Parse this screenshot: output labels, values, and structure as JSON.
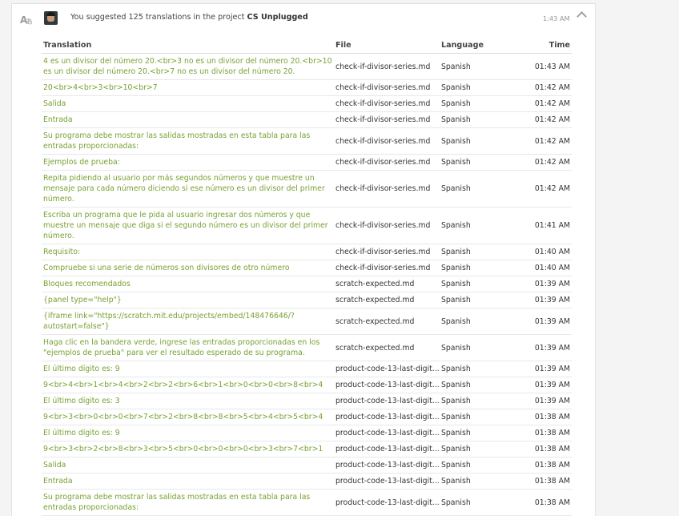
{
  "header": {
    "summary_prefix": "You suggested 125 translations in the project",
    "project": "CS Unplugged",
    "time": "1:43 AM"
  },
  "columns": {
    "translation": "Translation",
    "file": "File",
    "language": "Language",
    "time": "Time"
  },
  "rows": [
    {
      "translation": "4 es un divisor del número 20.<br>3 no es un divisor del número 20.<br>10 es un divisor del número 20.<br>7 no es un divisor del número 20.",
      "file": "check-if-divisor-series.md",
      "language": "Spanish",
      "time": "01:43 AM"
    },
    {
      "translation": "20<br>4<br>3<br>10<br>7",
      "file": "check-if-divisor-series.md",
      "language": "Spanish",
      "time": "01:42 AM"
    },
    {
      "translation": "Salida",
      "file": "check-if-divisor-series.md",
      "language": "Spanish",
      "time": "01:42 AM"
    },
    {
      "translation": "Entrada",
      "file": "check-if-divisor-series.md",
      "language": "Spanish",
      "time": "01:42 AM"
    },
    {
      "translation": "Su programa debe mostrar las salidas mostradas en esta tabla para las entradas proporcionadas:",
      "file": "check-if-divisor-series.md",
      "language": "Spanish",
      "time": "01:42 AM"
    },
    {
      "translation": "Ejemplos de prueba:",
      "file": "check-if-divisor-series.md",
      "language": "Spanish",
      "time": "01:42 AM"
    },
    {
      "translation": "Repita pidiendo al usuario por más segundos números y que muestre un mensaje para cada número diciendo si ese número es un divisor del primer número.",
      "file": "check-if-divisor-series.md",
      "language": "Spanish",
      "time": "01:42 AM"
    },
    {
      "translation": "Escriba un programa que le pida al usuario ingresar dos números y que muestre un mensaje que diga si el segundo número es un divisor del primer número.",
      "file": "check-if-divisor-series.md",
      "language": "Spanish",
      "time": "01:41 AM"
    },
    {
      "translation": "Requisito:",
      "file": "check-if-divisor-series.md",
      "language": "Spanish",
      "time": "01:40 AM"
    },
    {
      "translation": "Compruebe si una serie de números son divisores de otro número",
      "file": "check-if-divisor-series.md",
      "language": "Spanish",
      "time": "01:40 AM"
    },
    {
      "translation": "Bloques recomendados",
      "file": "scratch-expected.md",
      "language": "Spanish",
      "time": "01:39 AM"
    },
    {
      "translation": "{panel type=\"help\"}",
      "file": "scratch-expected.md",
      "language": "Spanish",
      "time": "01:39 AM"
    },
    {
      "translation": "{iframe link=\"https://scratch.mit.edu/projects/embed/148476646/?autostart=false\"}",
      "file": "scratch-expected.md",
      "language": "Spanish",
      "time": "01:39 AM"
    },
    {
      "translation": "Haga clic en la bandera verde, ingrese las entradas proporcionadas en los \"ejemplos de prueba\" para ver el resultado esperado de su programa.",
      "file": "scratch-expected.md",
      "language": "Spanish",
      "time": "01:39 AM"
    },
    {
      "translation": "El último dígito es: 9",
      "file": "product-code-13-last-digit...",
      "language": "Spanish",
      "time": "01:39 AM"
    },
    {
      "translation": "9<br>4<br>1<br>4<br>2<br>2<br>6<br>1<br>0<br>0<br>8<br>4",
      "file": "product-code-13-last-digit...",
      "language": "Spanish",
      "time": "01:39 AM"
    },
    {
      "translation": "El último dígito es: 3",
      "file": "product-code-13-last-digit...",
      "language": "Spanish",
      "time": "01:39 AM"
    },
    {
      "translation": "9<br>3<br>0<br>0<br>7<br>2<br>8<br>8<br>5<br>4<br>5<br>4",
      "file": "product-code-13-last-digit...",
      "language": "Spanish",
      "time": "01:38 AM"
    },
    {
      "translation": "El último dígito es: 9",
      "file": "product-code-13-last-digit...",
      "language": "Spanish",
      "time": "01:38 AM"
    },
    {
      "translation": "9<br>3<br>2<br>8<br>3<br>5<br>0<br>0<br>0<br>3<br>7<br>1",
      "file": "product-code-13-last-digit...",
      "language": "Spanish",
      "time": "01:38 AM"
    },
    {
      "translation": "Salida",
      "file": "product-code-13-last-digit...",
      "language": "Spanish",
      "time": "01:38 AM"
    },
    {
      "translation": "Entrada",
      "file": "product-code-13-last-digit...",
      "language": "Spanish",
      "time": "01:38 AM"
    },
    {
      "translation": "Su programa debe mostrar las salidas mostradas en esta tabla para las entradas proporcionadas:",
      "file": "product-code-13-last-digit...",
      "language": "Spanish",
      "time": "01:38 AM"
    }
  ]
}
